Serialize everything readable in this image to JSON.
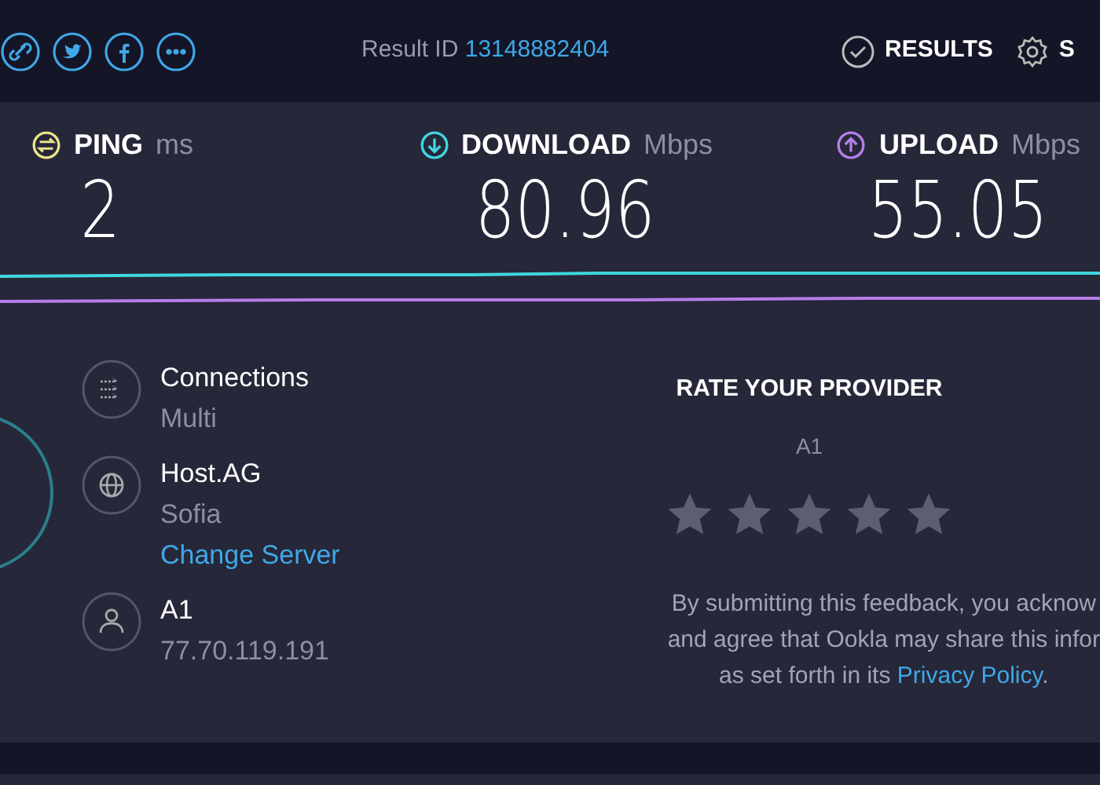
{
  "top_bar": {
    "result_label": "Result ID",
    "result_id": "13148882404",
    "nav": [
      {
        "kind": "results",
        "label": "RESULTS"
      },
      {
        "kind": "settings",
        "label": "S"
      }
    ]
  },
  "stats": [
    {
      "kind": "ping",
      "label": "PING",
      "unit": "ms",
      "value": "2",
      "color": "#e9e28a"
    },
    {
      "kind": "download",
      "label": "DOWNLOAD",
      "unit": "Mbps",
      "value": "80.96",
      "color": "#3fd6e0"
    },
    {
      "kind": "upload",
      "label": "UPLOAD",
      "unit": "Mbps",
      "value": "55.05",
      "color": "#b57ee8"
    }
  ],
  "details": [
    {
      "kind": "connections",
      "title": "Connections",
      "subtitle": "Multi"
    },
    {
      "kind": "server",
      "title": "Host.AG",
      "subtitle": "Sofia",
      "link": "Change Server"
    },
    {
      "kind": "provider",
      "title": "A1",
      "subtitle": "77.70.119.191"
    }
  ],
  "rating": {
    "heading": "RATE YOUR PROVIDER",
    "provider": "A1",
    "stars": 0,
    "notice_lines": [
      "By submitting this feedback, you acknow",
      "and agree that Ookla may share this infor",
      "as set forth in its"
    ],
    "notice_link": "Privacy Policy",
    "notice_end": "."
  }
}
